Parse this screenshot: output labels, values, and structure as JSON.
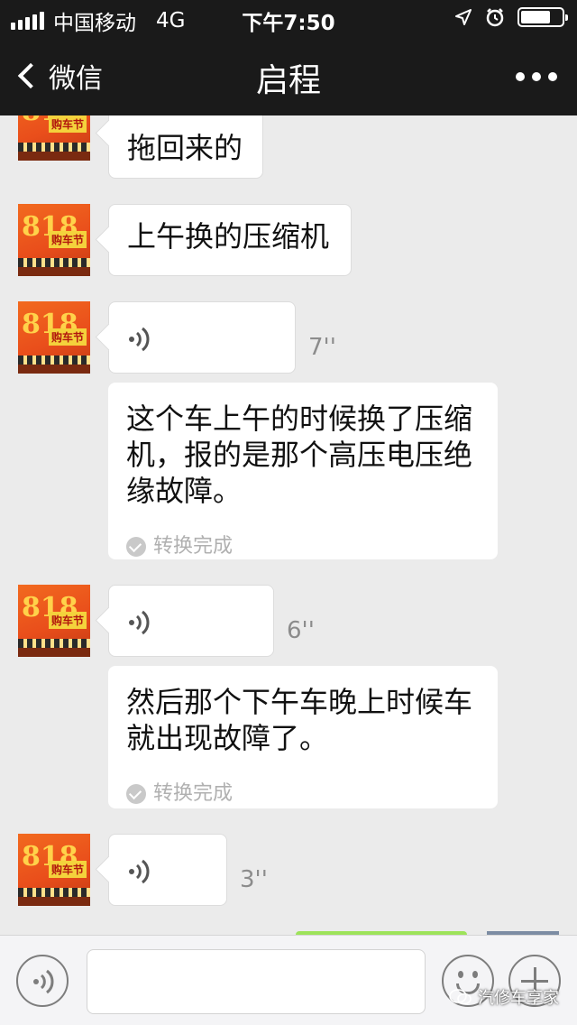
{
  "status_bar": {
    "carrier": "中国移动",
    "network": "4G",
    "time": "下午7:50"
  },
  "navbar": {
    "back_label": "微信",
    "title": "启程"
  },
  "messages": {
    "m1": {
      "text": "拖回来的"
    },
    "m2": {
      "text": "上午换的压缩机"
    },
    "m3": {
      "duration": "7''",
      "transcript": "这个车上午的时候换了压缩机，报的是那个高压电压绝缘故障。",
      "status": "转换完成"
    },
    "m4": {
      "duration": "6''",
      "transcript": "然后那个下午车晚上时候车就出现故障了。",
      "status": "转换完成"
    },
    "m5": {
      "duration": "3''"
    }
  },
  "avatar": {
    "big_text": "818",
    "tag_text": "购车节"
  },
  "watermark": "汽修车享家",
  "colors": {
    "bar_bg": "#1a1a1a",
    "chat_bg": "#ebebeb",
    "avatar_orange": "#e94e1b",
    "sent_green": "#9de35a"
  }
}
